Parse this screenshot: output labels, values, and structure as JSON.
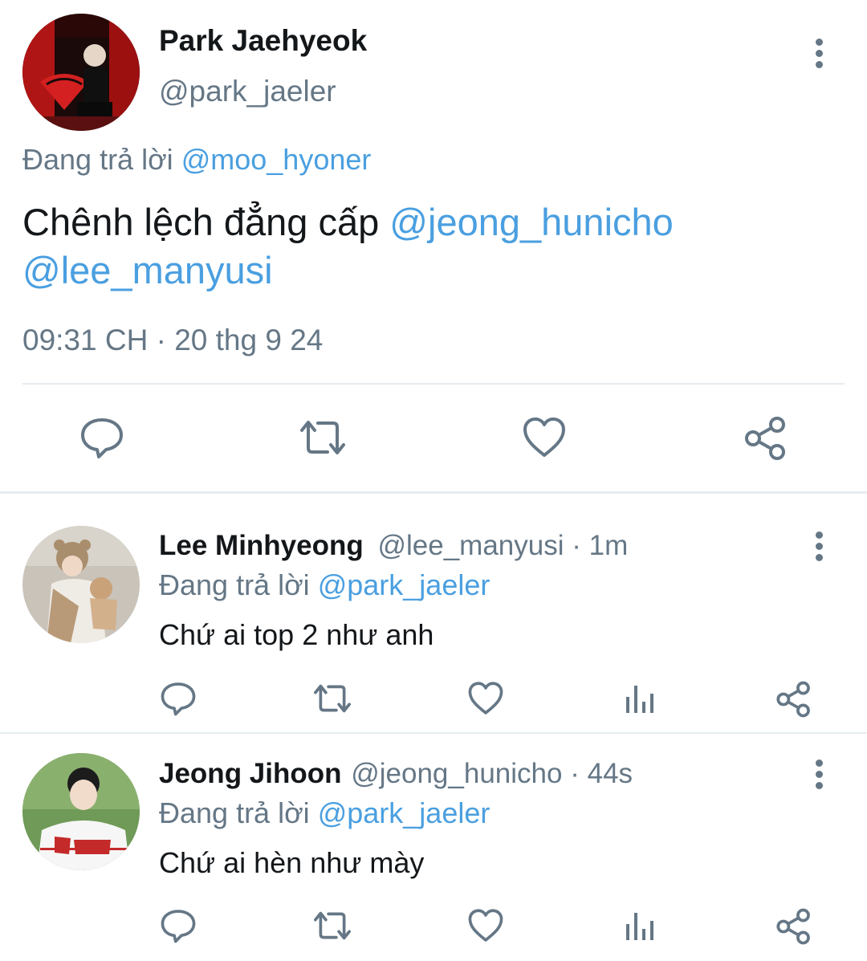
{
  "main_tweet": {
    "author_name": "Park Jaehyeok",
    "author_handle": "@park_jaeler",
    "replying_label": "Đang trả lời",
    "replying_to": "@moo_hyoner",
    "text": "Chênh lệch đẳng cấp",
    "mention_1": "@jeong_hunicho",
    "mention_2": "@lee_manyusi",
    "timestamp": "09:31 CH · 20 thg 9 24",
    "actions": [
      "comment-icon",
      "retweet-icon",
      "heart-icon",
      "share-icon"
    ]
  },
  "replies": [
    {
      "author_name": "Lee Minhyeong",
      "author_handle": "@lee_manyusi",
      "time": "· 1m",
      "replying_label": "Đang trả lời",
      "replying_to": "@park_jaeler",
      "text": "Chứ ai top 2 như anh",
      "actions": [
        "comment-icon",
        "retweet-icon",
        "heart-icon",
        "analytics-icon",
        "share-icon"
      ]
    },
    {
      "author_name": "Jeong Jihoon",
      "author_handle": "@jeong_hunicho",
      "time": "· 44s",
      "replying_label": "Đang trả lời",
      "replying_to": "@park_jaeler",
      "text": "Chứ ai hèn như mày",
      "actions": [
        "comment-icon",
        "retweet-icon",
        "heart-icon",
        "analytics-icon",
        "share-icon"
      ]
    }
  ],
  "colors": {
    "link": "#4a9fe0",
    "muted": "#657786",
    "divider": "#e6ecf0"
  }
}
